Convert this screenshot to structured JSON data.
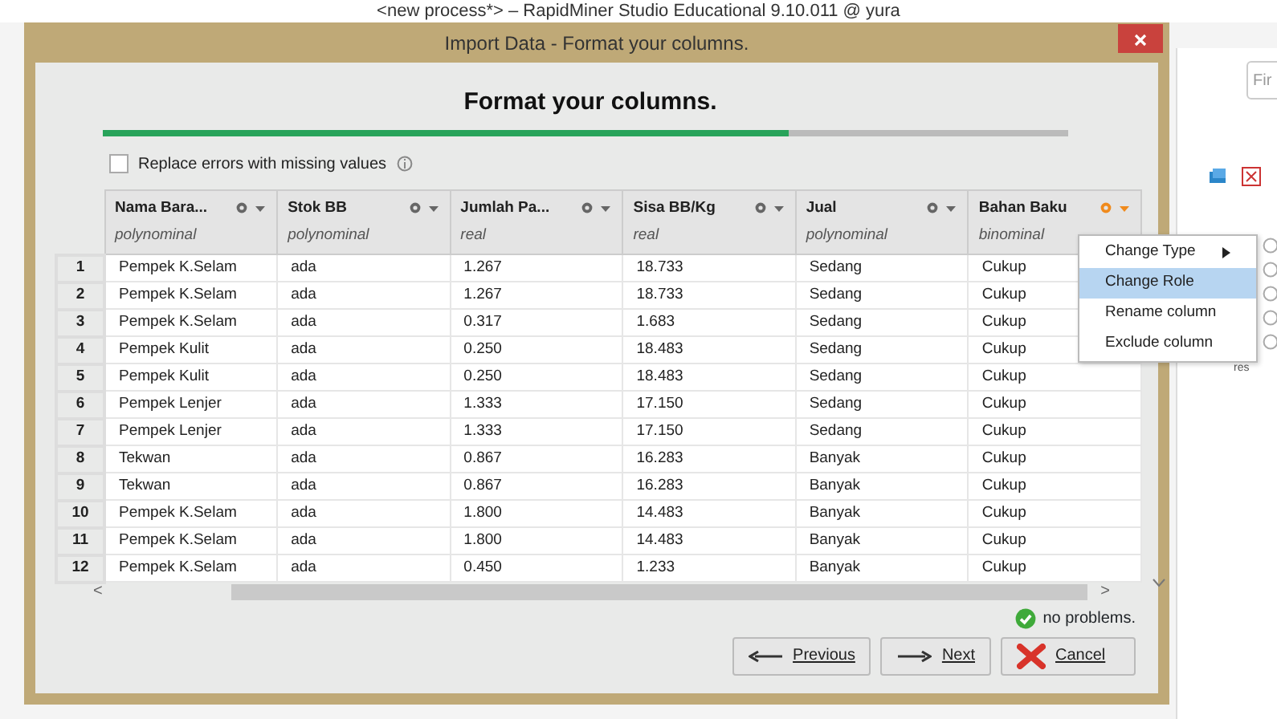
{
  "app": {
    "title": "<new process*> – RapidMiner Studio Educational 9.10.011 @ yura",
    "search": {
      "placeholder": "Fir"
    },
    "side_label": "res",
    "radios": [
      {
        "checked": false
      },
      {
        "checked": false
      },
      {
        "checked": false
      },
      {
        "checked": false
      },
      {
        "checked": false
      }
    ]
  },
  "dialog": {
    "title": "Import Data - Format your columns.",
    "heading": "Format your columns.",
    "progress": {
      "level": 0.71
    },
    "replace_errors": {
      "label": "Replace errors with missing values",
      "checked": false
    },
    "table": {
      "columns": [
        {
          "name": "Nama Bara...",
          "type": "polynominal",
          "menu_open": false
        },
        {
          "name": "Stok BB",
          "type": "polynominal",
          "menu_open": false
        },
        {
          "name": "Jumlah Pa...",
          "type": "real",
          "menu_open": false
        },
        {
          "name": "Sisa BB/Kg",
          "type": "real",
          "menu_open": false
        },
        {
          "name": "Jual",
          "type": "polynominal",
          "menu_open": false
        },
        {
          "name": "Bahan Baku",
          "type": "binominal",
          "menu_open": true
        }
      ],
      "rows": [
        {
          "index": "1",
          "cells": [
            "Pempek K.Selam",
            "ada",
            "1.267",
            "18.733",
            "Sedang",
            "Cukup"
          ]
        },
        {
          "index": "2",
          "cells": [
            "Pempek K.Selam",
            "ada",
            "1.267",
            "18.733",
            "Sedang",
            "Cukup"
          ]
        },
        {
          "index": "3",
          "cells": [
            "Pempek K.Selam",
            "ada",
            "0.317",
            "1.683",
            "Sedang",
            "Cukup"
          ]
        },
        {
          "index": "4",
          "cells": [
            "Pempek Kulit",
            "ada",
            "0.250",
            "18.483",
            "Sedang",
            "Cukup"
          ]
        },
        {
          "index": "5",
          "cells": [
            "Pempek Kulit",
            "ada",
            "0.250",
            "18.483",
            "Sedang",
            "Cukup"
          ]
        },
        {
          "index": "6",
          "cells": [
            "Pempek Lenjer",
            "ada",
            "1.333",
            "17.150",
            "Sedang",
            "Cukup"
          ]
        },
        {
          "index": "7",
          "cells": [
            "Pempek Lenjer",
            "ada",
            "1.333",
            "17.150",
            "Sedang",
            "Cukup"
          ]
        },
        {
          "index": "8",
          "cells": [
            "Tekwan",
            "ada",
            "0.867",
            "16.283",
            "Banyak",
            "Cukup"
          ]
        },
        {
          "index": "9",
          "cells": [
            "Tekwan",
            "ada",
            "0.867",
            "16.283",
            "Banyak",
            "Cukup"
          ]
        },
        {
          "index": "10",
          "cells": [
            "Pempek K.Selam",
            "ada",
            "1.800",
            "14.483",
            "Banyak",
            "Cukup"
          ]
        },
        {
          "index": "11",
          "cells": [
            "Pempek K.Selam",
            "ada",
            "1.800",
            "14.483",
            "Banyak",
            "Cukup"
          ]
        },
        {
          "index": "12",
          "cells": [
            "Pempek K.Selam",
            "ada",
            "0.450",
            "1.233",
            "Banyak",
            "Cukup"
          ]
        }
      ]
    },
    "column_menu": [
      {
        "label": "Change Type",
        "submenu": true,
        "selected": false
      },
      {
        "label": "Change Role",
        "submenu": false,
        "selected": true
      },
      {
        "label": "Rename column",
        "submenu": false,
        "selected": false
      },
      {
        "label": "Exclude column",
        "submenu": false,
        "selected": false
      }
    ],
    "scroll_left": "<",
    "scroll_right": ">",
    "status": "no problems.",
    "buttons": [
      {
        "kind": "previous",
        "label": "Previous"
      },
      {
        "kind": "next",
        "label": "Next"
      },
      {
        "kind": "cancel",
        "label": "Cancel"
      }
    ]
  }
}
